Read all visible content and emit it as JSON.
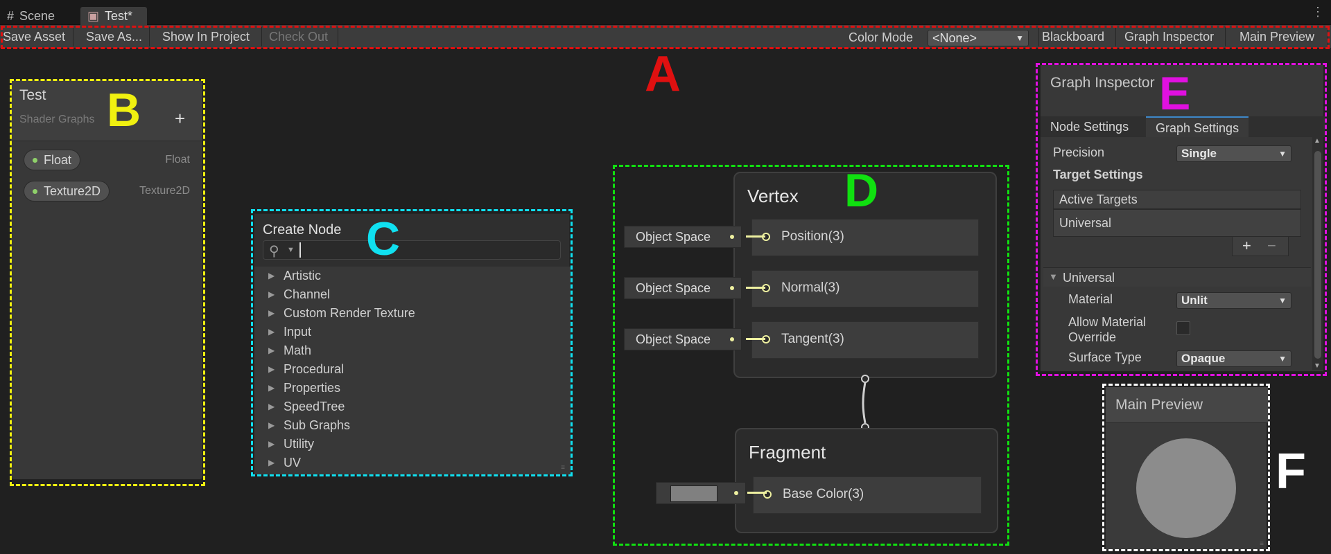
{
  "tabs": {
    "scene": "Scene",
    "test": "Test*"
  },
  "toolbar": {
    "save_asset": "Save Asset",
    "save_as": "Save As...",
    "show_in_project": "Show In Project",
    "check_out": "Check Out",
    "color_mode_label": "Color Mode",
    "color_mode_value": "<None>",
    "blackboard": "Blackboard",
    "graph_inspector": "Graph Inspector",
    "main_preview": "Main Preview"
  },
  "annotations": {
    "a": {
      "letter": "A",
      "color": "#e01010"
    },
    "b": {
      "letter": "B",
      "color": "#f0f010"
    },
    "c": {
      "letter": "C",
      "color": "#10e0f0"
    },
    "d": {
      "letter": "D",
      "color": "#10e010"
    },
    "e": {
      "letter": "E",
      "color": "#e010e0"
    },
    "f": {
      "letter": "F",
      "color": "#ffffff"
    }
  },
  "blackboard": {
    "title": "Test",
    "subtitle": "Shader Graphs",
    "add": "+",
    "properties": [
      {
        "name": "Float",
        "type": "Float"
      },
      {
        "name": "Texture2D",
        "type": "Texture2D"
      }
    ]
  },
  "create_node": {
    "title": "Create Node",
    "search_value": "",
    "items": [
      "Artistic",
      "Channel",
      "Custom Render Texture",
      "Input",
      "Math",
      "Procedural",
      "Properties",
      "SpeedTree",
      "Sub Graphs",
      "Utility",
      "UV"
    ]
  },
  "master_stack": {
    "vertex": {
      "title": "Vertex",
      "blocks": [
        {
          "label": "Position(3)",
          "input": "Object Space"
        },
        {
          "label": "Normal(3)",
          "input": "Object Space"
        },
        {
          "label": "Tangent(3)",
          "input": "Object Space"
        }
      ]
    },
    "fragment": {
      "title": "Fragment",
      "blocks": [
        {
          "label": "Base Color(3)",
          "swatch_color": "#808080"
        }
      ]
    }
  },
  "graph_inspector": {
    "title": "Graph Inspector",
    "tabs": [
      "Node Settings",
      "Graph Settings"
    ],
    "active_tab": "Graph Settings",
    "precision_label": "Precision",
    "precision_value": "Single",
    "target_settings": "Target Settings",
    "active_targets": "Active Targets",
    "targets": [
      "Universal"
    ],
    "add": "+",
    "remove": "−",
    "section": "Universal",
    "material_label": "Material",
    "material_value": "Unlit",
    "allow_override_label_1": "Allow Material",
    "allow_override_label_2": "Override",
    "allow_override_checked": false,
    "surface_type_label": "Surface Type",
    "surface_type_value": "Opaque"
  },
  "main_preview": {
    "title": "Main Preview",
    "sphere_color": "#8c8c8c"
  }
}
